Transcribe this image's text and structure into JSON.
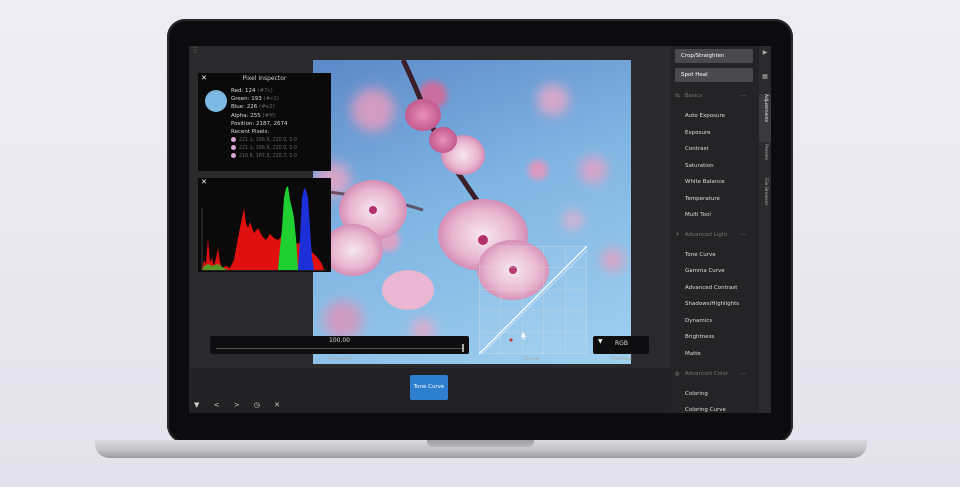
{
  "pixel_inspector": {
    "title": "Pixel Inspector",
    "close": "✕",
    "red_label": "Red: 124",
    "red_hex": "(#7c)",
    "green_label": "Green: 193",
    "green_hex": "(#c1)",
    "blue_label": "Blue: 226",
    "blue_hex": "(#e2)",
    "alpha_label": "Alpha: 255",
    "alpha_hex": "(#ff)",
    "position": "Position: 2187, 2674",
    "recent_title": "Recent Pixels:",
    "recent": [
      "221.1, 166.6, 220.0, 0.0",
      "221.1, 166.6, 220.0, 0.0",
      "216.8, 167.8, 220.7, 0.0"
    ],
    "swatch_color": "#7cb9e2"
  },
  "histogram": {
    "close": "✕"
  },
  "controls": {
    "amount_value": "100.00",
    "amount_label": "Amount",
    "curve_label": "Curve",
    "method_value": "RGB",
    "method_label": "Method",
    "method_arrow": "▼"
  },
  "bottom": {
    "tone_curve_button": "Tone Curve",
    "tools": "▼ < > ◷ ✕"
  },
  "panel": {
    "crop_button": "Crop/Straighten",
    "spot_heal_button": "Spot Heal",
    "sections": [
      {
        "name": "Basics",
        "icon": "⇆",
        "items": [
          "Auto Exposure",
          "Exposure",
          "Contrast",
          "Saturation",
          "White Balance",
          "Temperature",
          "Multi Tool"
        ]
      },
      {
        "name": "Advanced Light",
        "icon": "☀",
        "items": [
          "Tone Curve",
          "Gamma Curve",
          "Advanced Contrast",
          "Shadows/Highlights",
          "Dynamics",
          "Brightness",
          "Matte"
        ]
      },
      {
        "name": "Advanced Color",
        "icon": "◍",
        "items": [
          "Coloring",
          "Coloring Curve"
        ]
      }
    ],
    "section_dash": "—"
  },
  "vtabs": {
    "collapse": "▶",
    "grid": "▦",
    "adjustments": "Adjustments",
    "presets": "Presets",
    "file_browser": "File Browser"
  },
  "colors": {
    "accent": "#2f7fd0",
    "panel_bg": "#242427"
  }
}
